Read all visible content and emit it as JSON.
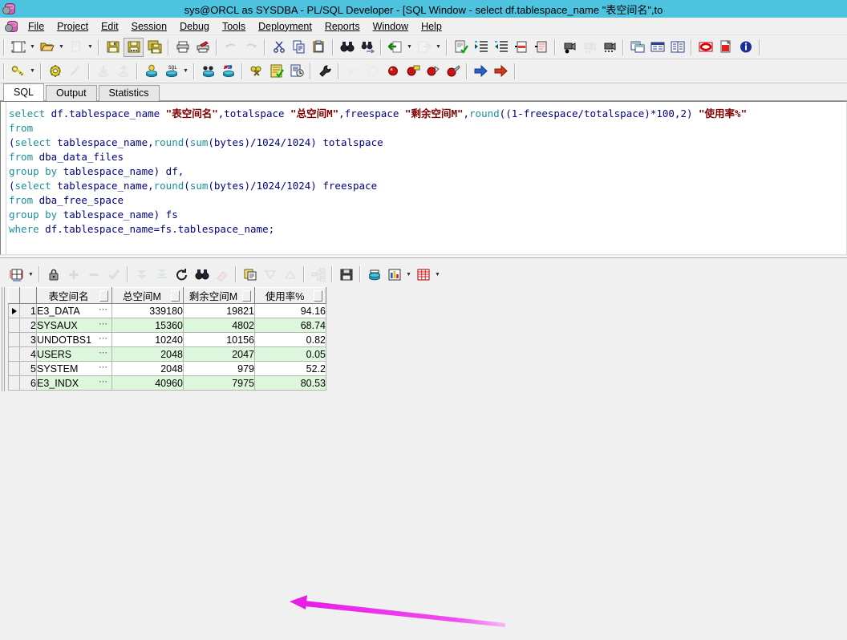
{
  "window": {
    "title": "sys@ORCL as SYSDBA - PL/SQL Developer - [SQL Window - select df.tablespace_name \"表空间名\",to",
    "app_icon": "database-gear-icon"
  },
  "menu": {
    "items": [
      {
        "label": "File"
      },
      {
        "label": "Project"
      },
      {
        "label": "Edit"
      },
      {
        "label": "Session"
      },
      {
        "label": "Debug"
      },
      {
        "label": "Tools"
      },
      {
        "label": "Deployment"
      },
      {
        "label": "Reports"
      },
      {
        "label": "Window"
      },
      {
        "label": "Help"
      }
    ]
  },
  "toolbar_main": {
    "groups": [
      {
        "buttons": [
          {
            "icon": "new-document-icon",
            "dropdown": true
          },
          {
            "icon": "open-folder-icon",
            "dropdown": true
          },
          {
            "icon": "print-preview-icon",
            "dropdown": true,
            "disabled": true
          }
        ]
      },
      {
        "buttons": [
          {
            "icon": "save-icon"
          },
          {
            "icon": "save-as-icon",
            "pressed": true
          },
          {
            "icon": "save-all-icon"
          }
        ]
      },
      {
        "buttons": [
          {
            "icon": "print-icon"
          },
          {
            "icon": "print-setup-icon"
          }
        ]
      },
      {
        "buttons": [
          {
            "icon": "undo-icon",
            "disabled": true
          },
          {
            "icon": "redo-icon",
            "disabled": true
          }
        ]
      },
      {
        "buttons": [
          {
            "icon": "cut-scissors-icon"
          },
          {
            "icon": "copy-icon"
          },
          {
            "icon": "paste-clipboard-icon"
          }
        ]
      },
      {
        "buttons": [
          {
            "icon": "find-binoculars-icon"
          },
          {
            "icon": "find-next-icon"
          }
        ]
      },
      {
        "buttons": [
          {
            "icon": "import-green-arrow-icon",
            "dropdown": true
          },
          {
            "icon": "export-document-icon",
            "dropdown": true,
            "disabled": true
          }
        ]
      },
      {
        "buttons": [
          {
            "icon": "syntax-check-icon"
          },
          {
            "icon": "indent-increase-icon"
          },
          {
            "icon": "indent-decrease-icon"
          },
          {
            "icon": "comment-icon"
          },
          {
            "icon": "uncomment-icon"
          }
        ]
      },
      {
        "buttons": [
          {
            "icon": "record-macro-icon"
          },
          {
            "icon": "pause-macro-icon",
            "disabled": true
          },
          {
            "icon": "play-macro-icon"
          }
        ]
      },
      {
        "buttons": [
          {
            "icon": "tile-windows-icon"
          },
          {
            "icon": "cascade-windows-icon"
          },
          {
            "icon": "split-windows-icon"
          }
        ]
      },
      {
        "buttons": [
          {
            "icon": "oracle-red-icon"
          },
          {
            "icon": "pdf-export-icon"
          },
          {
            "icon": "about-info-icon"
          }
        ]
      }
    ]
  },
  "toolbar_session": {
    "groups": [
      {
        "buttons": [
          {
            "icon": "key-login-icon",
            "dropdown": true
          }
        ]
      },
      {
        "buttons": [
          {
            "icon": "gear-settings-icon"
          },
          {
            "icon": "wand-icon",
            "disabled": true
          }
        ]
      },
      {
        "buttons": [
          {
            "icon": "commit-download-icon",
            "disabled": true
          },
          {
            "icon": "rollback-upload-icon",
            "disabled": true
          }
        ]
      },
      {
        "buttons": [
          {
            "icon": "execute-lightbulb-icon"
          },
          {
            "icon": "new-sql-window-icon",
            "dropdown": true
          }
        ]
      },
      {
        "buttons": [
          {
            "icon": "explain-plan-icon"
          },
          {
            "icon": "break-session-icon"
          }
        ]
      },
      {
        "buttons": [
          {
            "icon": "session-keys-icon"
          },
          {
            "icon": "test-script-icon"
          },
          {
            "icon": "session-history-icon"
          }
        ]
      },
      {
        "buttons": [
          {
            "icon": "wrench-tools-icon"
          }
        ]
      },
      {
        "buttons": [
          {
            "icon": "step-over-icon",
            "disabled": true
          },
          {
            "icon": "step-out-icon",
            "disabled": true
          },
          {
            "icon": "breakpoint-red-icon"
          },
          {
            "icon": "breakpoint-add-icon"
          },
          {
            "icon": "breakpoint-toggle-icon"
          },
          {
            "icon": "breakpoint-clear-icon"
          }
        ]
      },
      {
        "buttons": [
          {
            "icon": "next-blue-arrow-icon"
          },
          {
            "icon": "run-red-arrow-icon"
          }
        ]
      }
    ]
  },
  "tabs": [
    {
      "label": "SQL",
      "active": true
    },
    {
      "label": "Output",
      "active": false
    },
    {
      "label": "Statistics",
      "active": false
    }
  ],
  "editor": {
    "lines": [
      [
        {
          "t": "select",
          "c": "kw"
        },
        {
          "t": " df.tablespace_name ",
          "c": "pl"
        },
        {
          "t": "\"表空间名\"",
          "c": "str"
        },
        {
          "t": ",totalspace ",
          "c": "pl"
        },
        {
          "t": "\"总空间M\"",
          "c": "str"
        },
        {
          "t": ",freespace ",
          "c": "pl"
        },
        {
          "t": "\"剩余空间M\"",
          "c": "str"
        },
        {
          "t": ",",
          "c": "pl"
        },
        {
          "t": "round",
          "c": "fn"
        },
        {
          "t": "((1-freespace/totalspace)*100,2) ",
          "c": "pl"
        },
        {
          "t": "\"使用率%\"",
          "c": "str"
        }
      ],
      [
        {
          "t": "from",
          "c": "kw"
        }
      ],
      [
        {
          "t": "(",
          "c": "pl"
        },
        {
          "t": "select",
          "c": "kw"
        },
        {
          "t": " tablespace_name,",
          "c": "pl"
        },
        {
          "t": "round",
          "c": "fn"
        },
        {
          "t": "(",
          "c": "pl"
        },
        {
          "t": "sum",
          "c": "fn"
        },
        {
          "t": "(bytes)/1024/1024) totalspace",
          "c": "pl"
        }
      ],
      [
        {
          "t": "from",
          "c": "kw"
        },
        {
          "t": " dba_data_files",
          "c": "pl"
        }
      ],
      [
        {
          "t": "group by",
          "c": "kw"
        },
        {
          "t": " tablespace_name) df,",
          "c": "pl"
        }
      ],
      [
        {
          "t": "(",
          "c": "pl"
        },
        {
          "t": "select",
          "c": "kw"
        },
        {
          "t": " tablespace_name,",
          "c": "pl"
        },
        {
          "t": "round",
          "c": "fn"
        },
        {
          "t": "(",
          "c": "pl"
        },
        {
          "t": "sum",
          "c": "fn"
        },
        {
          "t": "(bytes)/1024/1024) freespace",
          "c": "pl"
        }
      ],
      [
        {
          "t": "from",
          "c": "kw"
        },
        {
          "t": " dba_free_space",
          "c": "pl"
        }
      ],
      [
        {
          "t": "group by",
          "c": "kw"
        },
        {
          "t": " tablespace_name) fs",
          "c": "pl"
        }
      ],
      [
        {
          "t": "where",
          "c": "kw"
        },
        {
          "t": " df.tablespace_name=fs.tablespace_name;",
          "c": "pl"
        }
      ]
    ]
  },
  "result_toolbar": {
    "buttons": [
      {
        "icon": "grid-layout-icon",
        "dropdown": true
      },
      {
        "sep": true
      },
      {
        "icon": "lock-record-icon"
      },
      {
        "icon": "insert-record-plus-icon",
        "disabled": true
      },
      {
        "icon": "delete-record-minus-icon",
        "disabled": true
      },
      {
        "icon": "post-change-check-icon",
        "disabled": true
      },
      {
        "sep": true
      },
      {
        "icon": "fetch-next-page-icon",
        "disabled": true
      },
      {
        "icon": "fetch-last-page-icon",
        "disabled": true
      },
      {
        "icon": "refresh-icon"
      },
      {
        "icon": "find-binoculars-icon"
      },
      {
        "icon": "clear-filter-eraser-icon",
        "disabled": true
      },
      {
        "sep": true
      },
      {
        "icon": "copy-to-clipboard-icon"
      },
      {
        "icon": "sort-descending-icon",
        "disabled": true
      },
      {
        "icon": "sort-ascending-icon",
        "disabled": true
      },
      {
        "sep": true
      },
      {
        "icon": "query-structure-icon",
        "disabled": true
      },
      {
        "sep": true
      },
      {
        "icon": "export-save-icon"
      },
      {
        "sep": true
      },
      {
        "icon": "query-data-icon"
      },
      {
        "icon": "chart-bar-icon",
        "dropdown": true
      },
      {
        "icon": "table-red-icon",
        "dropdown": true
      }
    ]
  },
  "grid": {
    "columns": [
      {
        "label": "表空间名"
      },
      {
        "label": "总空间M"
      },
      {
        "label": "剩余空间M"
      },
      {
        "label": "使用率%"
      }
    ],
    "rows": [
      {
        "num": "1",
        "selected": true,
        "cells": [
          "E3_DATA",
          "339180",
          "19821",
          "94.16"
        ]
      },
      {
        "num": "2",
        "selected": false,
        "cells": [
          "SYSAUX",
          "15360",
          "4802",
          "68.74"
        ]
      },
      {
        "num": "3",
        "selected": false,
        "cells": [
          "UNDOTBS1",
          "10240",
          "10156",
          "0.82"
        ]
      },
      {
        "num": "4",
        "selected": false,
        "cells": [
          "USERS",
          "2048",
          "2047",
          "0.05"
        ]
      },
      {
        "num": "5",
        "selected": false,
        "cells": [
          "SYSTEM",
          "2048",
          "979",
          "52.2"
        ]
      },
      {
        "num": "6",
        "selected": false,
        "cells": [
          "E3_INDX",
          "40960",
          "7975",
          "80.53"
        ]
      }
    ],
    "cell_overflow_marker": "⋯"
  },
  "annotation": {
    "type": "arrow",
    "color": "#e61ee6",
    "points_to_row": "1",
    "direction": "left"
  },
  "colors": {
    "titlebar": "#4ec3e0",
    "chrome": "#f0f0f0",
    "keyword": "#1a8f9c",
    "string": "#800000",
    "plain": "#000080",
    "row_alt": "#ddf7dd",
    "annotation": "#e61ee6"
  }
}
